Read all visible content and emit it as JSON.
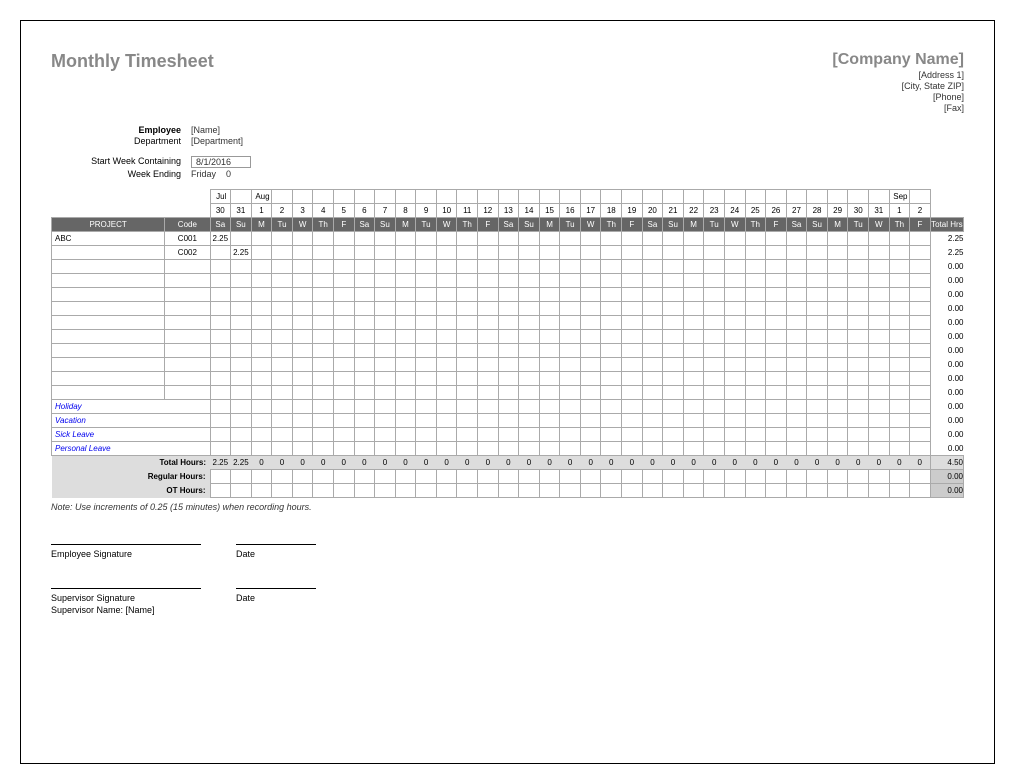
{
  "title": "Monthly Timesheet",
  "company": {
    "name": "[Company Name]",
    "address1": "[Address 1]",
    "city_state_zip": "[City, State ZIP]",
    "phone": "[Phone]",
    "fax": "[Fax]"
  },
  "info": {
    "employee_label": "Employee",
    "employee_value": "[Name]",
    "department_label": "Department",
    "department_value": "[Department]",
    "start_week_label": "Start Week Containing",
    "start_week_value": "8/1/2016",
    "week_ending_label": "Week Ending",
    "week_ending_value": "Friday",
    "week_ending_code": "0"
  },
  "months": {
    "jul": "Jul",
    "aug": "Aug",
    "sep": "Sep"
  },
  "dates": [
    "30",
    "31",
    "1",
    "2",
    "3",
    "4",
    "5",
    "6",
    "7",
    "8",
    "9",
    "10",
    "11",
    "12",
    "13",
    "14",
    "15",
    "16",
    "17",
    "18",
    "19",
    "20",
    "21",
    "22",
    "23",
    "24",
    "25",
    "26",
    "27",
    "28",
    "29",
    "30",
    "31",
    "1",
    "2"
  ],
  "days": [
    "Sa",
    "Su",
    "M",
    "Tu",
    "W",
    "Th",
    "F",
    "Sa",
    "Su",
    "M",
    "Tu",
    "W",
    "Th",
    "F",
    "Sa",
    "Su",
    "M",
    "Tu",
    "W",
    "Th",
    "F",
    "Sa",
    "Su",
    "M",
    "Tu",
    "W",
    "Th",
    "F",
    "Sa",
    "Su",
    "M",
    "Tu",
    "W",
    "Th",
    "F"
  ],
  "headers": {
    "project": "PROJECT",
    "code": "Code",
    "total_hrs": "Total Hrs"
  },
  "rows": [
    {
      "project": "ABC",
      "code": "C001",
      "hours": [
        "2.25",
        "",
        "",
        "",
        "",
        "",
        "",
        "",
        "",
        "",
        "",
        "",
        "",
        "",
        "",
        "",
        "",
        "",
        "",
        "",
        "",
        "",
        "",
        "",
        "",
        "",
        "",
        "",
        "",
        "",
        "",
        "",
        "",
        "",
        ""
      ],
      "total": "2.25"
    },
    {
      "project": "",
      "code": "C002",
      "hours": [
        "",
        "2.25",
        "",
        "",
        "",
        "",
        "",
        "",
        "",
        "",
        "",
        "",
        "",
        "",
        "",
        "",
        "",
        "",
        "",
        "",
        "",
        "",
        "",
        "",
        "",
        "",
        "",
        "",
        "",
        "",
        "",
        "",
        "",
        "",
        ""
      ],
      "total": "2.25"
    },
    {
      "project": "",
      "code": "",
      "hours": [
        "",
        "",
        "",
        "",
        "",
        "",
        "",
        "",
        "",
        "",
        "",
        "",
        "",
        "",
        "",
        "",
        "",
        "",
        "",
        "",
        "",
        "",
        "",
        "",
        "",
        "",
        "",
        "",
        "",
        "",
        "",
        "",
        "",
        "",
        ""
      ],
      "total": "0.00"
    },
    {
      "project": "",
      "code": "",
      "hours": [
        "",
        "",
        "",
        "",
        "",
        "",
        "",
        "",
        "",
        "",
        "",
        "",
        "",
        "",
        "",
        "",
        "",
        "",
        "",
        "",
        "",
        "",
        "",
        "",
        "",
        "",
        "",
        "",
        "",
        "",
        "",
        "",
        "",
        "",
        ""
      ],
      "total": "0.00"
    },
    {
      "project": "",
      "code": "",
      "hours": [
        "",
        "",
        "",
        "",
        "",
        "",
        "",
        "",
        "",
        "",
        "",
        "",
        "",
        "",
        "",
        "",
        "",
        "",
        "",
        "",
        "",
        "",
        "",
        "",
        "",
        "",
        "",
        "",
        "",
        "",
        "",
        "",
        "",
        "",
        ""
      ],
      "total": "0.00"
    },
    {
      "project": "",
      "code": "",
      "hours": [
        "",
        "",
        "",
        "",
        "",
        "",
        "",
        "",
        "",
        "",
        "",
        "",
        "",
        "",
        "",
        "",
        "",
        "",
        "",
        "",
        "",
        "",
        "",
        "",
        "",
        "",
        "",
        "",
        "",
        "",
        "",
        "",
        "",
        "",
        ""
      ],
      "total": "0.00"
    },
    {
      "project": "",
      "code": "",
      "hours": [
        "",
        "",
        "",
        "",
        "",
        "",
        "",
        "",
        "",
        "",
        "",
        "",
        "",
        "",
        "",
        "",
        "",
        "",
        "",
        "",
        "",
        "",
        "",
        "",
        "",
        "",
        "",
        "",
        "",
        "",
        "",
        "",
        "",
        "",
        ""
      ],
      "total": "0.00"
    },
    {
      "project": "",
      "code": "",
      "hours": [
        "",
        "",
        "",
        "",
        "",
        "",
        "",
        "",
        "",
        "",
        "",
        "",
        "",
        "",
        "",
        "",
        "",
        "",
        "",
        "",
        "",
        "",
        "",
        "",
        "",
        "",
        "",
        "",
        "",
        "",
        "",
        "",
        "",
        "",
        ""
      ],
      "total": "0.00"
    },
    {
      "project": "",
      "code": "",
      "hours": [
        "",
        "",
        "",
        "",
        "",
        "",
        "",
        "",
        "",
        "",
        "",
        "",
        "",
        "",
        "",
        "",
        "",
        "",
        "",
        "",
        "",
        "",
        "",
        "",
        "",
        "",
        "",
        "",
        "",
        "",
        "",
        "",
        "",
        "",
        ""
      ],
      "total": "0.00"
    },
    {
      "project": "",
      "code": "",
      "hours": [
        "",
        "",
        "",
        "",
        "",
        "",
        "",
        "",
        "",
        "",
        "",
        "",
        "",
        "",
        "",
        "",
        "",
        "",
        "",
        "",
        "",
        "",
        "",
        "",
        "",
        "",
        "",
        "",
        "",
        "",
        "",
        "",
        "",
        "",
        ""
      ],
      "total": "0.00"
    },
    {
      "project": "",
      "code": "",
      "hours": [
        "",
        "",
        "",
        "",
        "",
        "",
        "",
        "",
        "",
        "",
        "",
        "",
        "",
        "",
        "",
        "",
        "",
        "",
        "",
        "",
        "",
        "",
        "",
        "",
        "",
        "",
        "",
        "",
        "",
        "",
        "",
        "",
        "",
        "",
        ""
      ],
      "total": "0.00"
    },
    {
      "project": "",
      "code": "",
      "hours": [
        "",
        "",
        "",
        "",
        "",
        "",
        "",
        "",
        "",
        "",
        "",
        "",
        "",
        "",
        "",
        "",
        "",
        "",
        "",
        "",
        "",
        "",
        "",
        "",
        "",
        "",
        "",
        "",
        "",
        "",
        "",
        "",
        "",
        "",
        ""
      ],
      "total": "0.00"
    }
  ],
  "leave_rows": [
    {
      "label": "Holiday",
      "total": "0.00"
    },
    {
      "label": "Vacation",
      "total": "0.00"
    },
    {
      "label": "Sick Leave",
      "total": "0.00"
    },
    {
      "label": "Personal Leave",
      "total": "0.00"
    }
  ],
  "totals": {
    "total_hours_label": "Total Hours:",
    "total_hours": [
      "2.25",
      "2.25",
      "0",
      "0",
      "0",
      "0",
      "0",
      "0",
      "0",
      "0",
      "0",
      "0",
      "0",
      "0",
      "0",
      "0",
      "0",
      "0",
      "0",
      "0",
      "0",
      "0",
      "0",
      "0",
      "0",
      "0",
      "0",
      "0",
      "0",
      "0",
      "0",
      "0",
      "0",
      "0",
      "0"
    ],
    "grand_total": "4.50",
    "regular_label": "Regular Hours:",
    "regular_total": "0.00",
    "ot_label": "OT Hours:",
    "ot_total": "0.00"
  },
  "note": "Note: Use increments of 0.25 (15 minutes) when recording hours.",
  "signatures": {
    "emp_sig": "Employee Signature",
    "date": "Date",
    "sup_sig": "Supervisor Signature",
    "sup_name_label": "Supervisor Name:",
    "sup_name_value": "[Name]"
  }
}
